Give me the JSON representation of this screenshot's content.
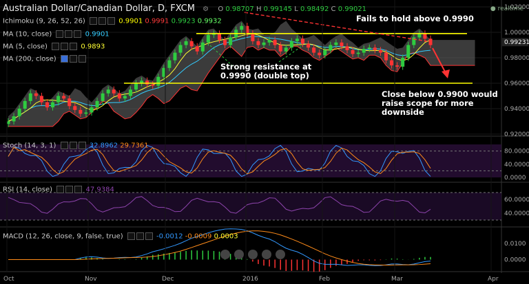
{
  "header": {
    "title": "Australian Dollar/Canadian Dollar, D, FXCM",
    "ohlc": [
      {
        "label": "O",
        "value": "0.98707"
      },
      {
        "label": "H",
        "value": "0.99145"
      },
      {
        "label": "L",
        "value": "0.98492"
      },
      {
        "label": "C",
        "value": "0.99021"
      }
    ],
    "realtime": "realtime"
  },
  "indicators": [
    {
      "label": "Ichimoku (9, 26, 52, 26)",
      "values": [
        "0.9901",
        "0.9991",
        "0.9923",
        "0.9932"
      ],
      "colors": [
        "#ffff00",
        "#ff3b3b",
        "#2ecc40",
        "#66ff66"
      ]
    },
    {
      "label": "MA (10, close)",
      "values": [
        "0.9901"
      ],
      "colors": [
        "#33ccff"
      ]
    },
    {
      "label": "MA (5, close)",
      "values": [
        "0.9893"
      ],
      "colors": [
        "#ffff33"
      ]
    },
    {
      "label": "MA (200, close)",
      "values": [],
      "colors": []
    }
  ],
  "price_axis": {
    "ticks": [
      "1.02000",
      "1.00000",
      "0.98000",
      "0.96000",
      "0.94000",
      "0.92000"
    ],
    "current": "0.99231"
  },
  "annotations": {
    "fails": "Fails to hold above 0.9990",
    "resistance_1": "Strong resistance at",
    "resistance_2": "0.9990 (double top)",
    "close_1": "Close below 0.9900 would",
    "close_2": "raise scope for more",
    "close_3": "downside"
  },
  "stoch": {
    "label": "Stoch (14, 3, 1)",
    "values": [
      "32.8962",
      "29.7361"
    ],
    "ticks": [
      "80.0000",
      "40.0000",
      "0.0000"
    ]
  },
  "rsi": {
    "label": "RSI (14, close)",
    "values": [
      "47.9384"
    ],
    "ticks": [
      "60.0000",
      "40.0000"
    ]
  },
  "macd": {
    "label": "MACD (12, 26, close, 9, false, true)",
    "values": [
      "-0.0012",
      "-0.0009",
      "0.0003"
    ],
    "ticks": [
      "0.0100",
      "0.0000"
    ]
  },
  "time_axis": [
    "Oct",
    "Nov",
    "Dec",
    "2016",
    "Feb",
    "Mar",
    "Apr"
  ],
  "colors": {
    "bull": "#2ecc40",
    "bear": "#ff3333",
    "ma10": "#33ccff",
    "ma5": "#ffff33",
    "level": "#ffff00",
    "trend": "#ff3333",
    "cloud": "#6b6b6b",
    "stochK": "#3399ff",
    "stochD": "#ff8c1a",
    "rsi": "#8e44ad",
    "macd": "#3399ff",
    "signal": "#ff8c1a"
  },
  "chart_data": {
    "type": "candlestick",
    "title": "Australian Dollar/Canadian Dollar, D, FXCM",
    "ylim": [
      0.92,
      1.02
    ],
    "levels": [
      0.999,
      0.96
    ],
    "close_approx": [
      0.93,
      0.934,
      0.94,
      0.946,
      0.952,
      0.95,
      0.945,
      0.941,
      0.945,
      0.95,
      0.948,
      0.942,
      0.939,
      0.936,
      0.937,
      0.941,
      0.946,
      0.952,
      0.955,
      0.952,
      0.948,
      0.95,
      0.955,
      0.96,
      0.962,
      0.959,
      0.958,
      0.965,
      0.972,
      0.978,
      0.984,
      0.99,
      0.993,
      0.989,
      0.985,
      0.992,
      0.998,
      0.999,
      0.994,
      0.99,
      0.996,
      1.002,
      1.005,
      0.999,
      0.993,
      0.99,
      0.992,
      0.994,
      0.99,
      0.985,
      0.988,
      0.993,
      0.995,
      0.991,
      0.988,
      0.984,
      0.982,
      0.986,
      0.99,
      0.992,
      0.989,
      0.986,
      0.983,
      0.984,
      0.987,
      0.988,
      0.986,
      0.984,
      0.978,
      0.974,
      0.973,
      0.98,
      0.99,
      0.996,
      0.999,
      0.995,
      0.99
    ]
  }
}
